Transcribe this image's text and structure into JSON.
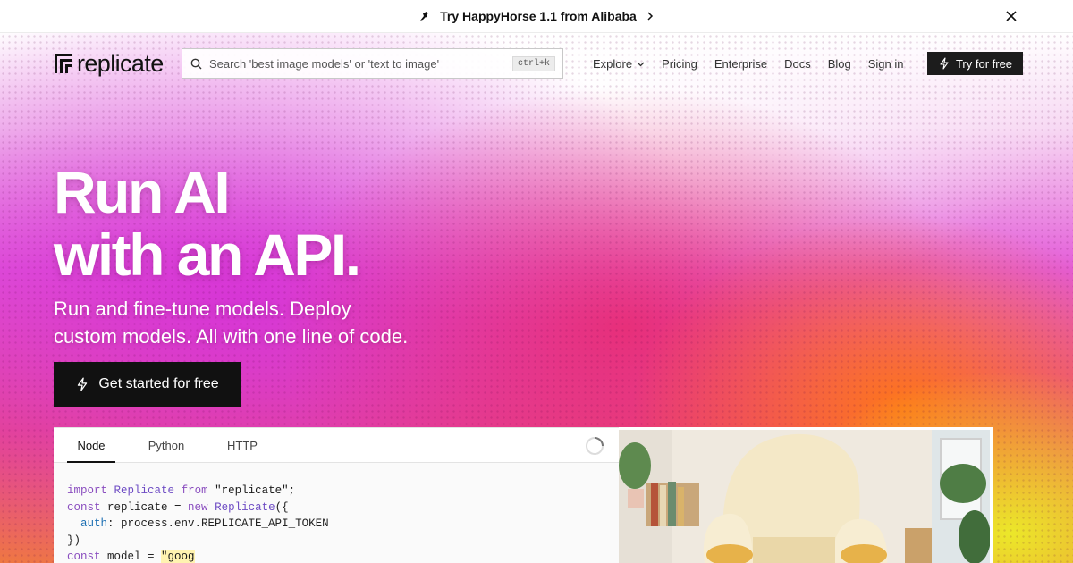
{
  "announcement": {
    "text": "Try HappyHorse 1.1 from Alibaba"
  },
  "nav": {
    "logo_text": "replicate",
    "search": {
      "placeholder": "Search 'best image models' or 'text to image'",
      "shortcut": "ctrl+k"
    },
    "links": [
      {
        "label": "Explore",
        "has_dropdown": true
      },
      {
        "label": "Pricing"
      },
      {
        "label": "Enterprise"
      },
      {
        "label": "Docs"
      },
      {
        "label": "Blog"
      },
      {
        "label": "Sign in"
      }
    ],
    "cta": "Try for free"
  },
  "hero": {
    "headline_line1": "Run AI",
    "headline_line2": "with an API.",
    "subhead_line1": "Run and fine-tune models. Deploy",
    "subhead_line2": "custom models. All with one line of code.",
    "cta": "Get started for free"
  },
  "code_panel": {
    "tabs": [
      "Node",
      "Python",
      "HTTP"
    ],
    "active_tab": "Node",
    "lines": {
      "l1": {
        "kw1": "import",
        "cls": "Replicate",
        "kw2": "from",
        "str": "\"replicate\"",
        "end": ";"
      },
      "l2": {
        "kw": "const",
        "name": "replicate = ",
        "kw_new": "new",
        "cls": "Replicate",
        "end": "({"
      },
      "l3": {
        "prop": "auth",
        "rest": ": process.env.REPLICATE_API_TOKEN"
      },
      "l4": {
        "text": "})"
      },
      "l5": {
        "kw": "const",
        "name": "model = ",
        "str": "\"goog"
      }
    }
  },
  "colors": {
    "accent_dark": "#111111",
    "hero_magenta": "#d634d6",
    "hero_orange": "#ff7814",
    "hero_yellow": "#ebee28"
  }
}
